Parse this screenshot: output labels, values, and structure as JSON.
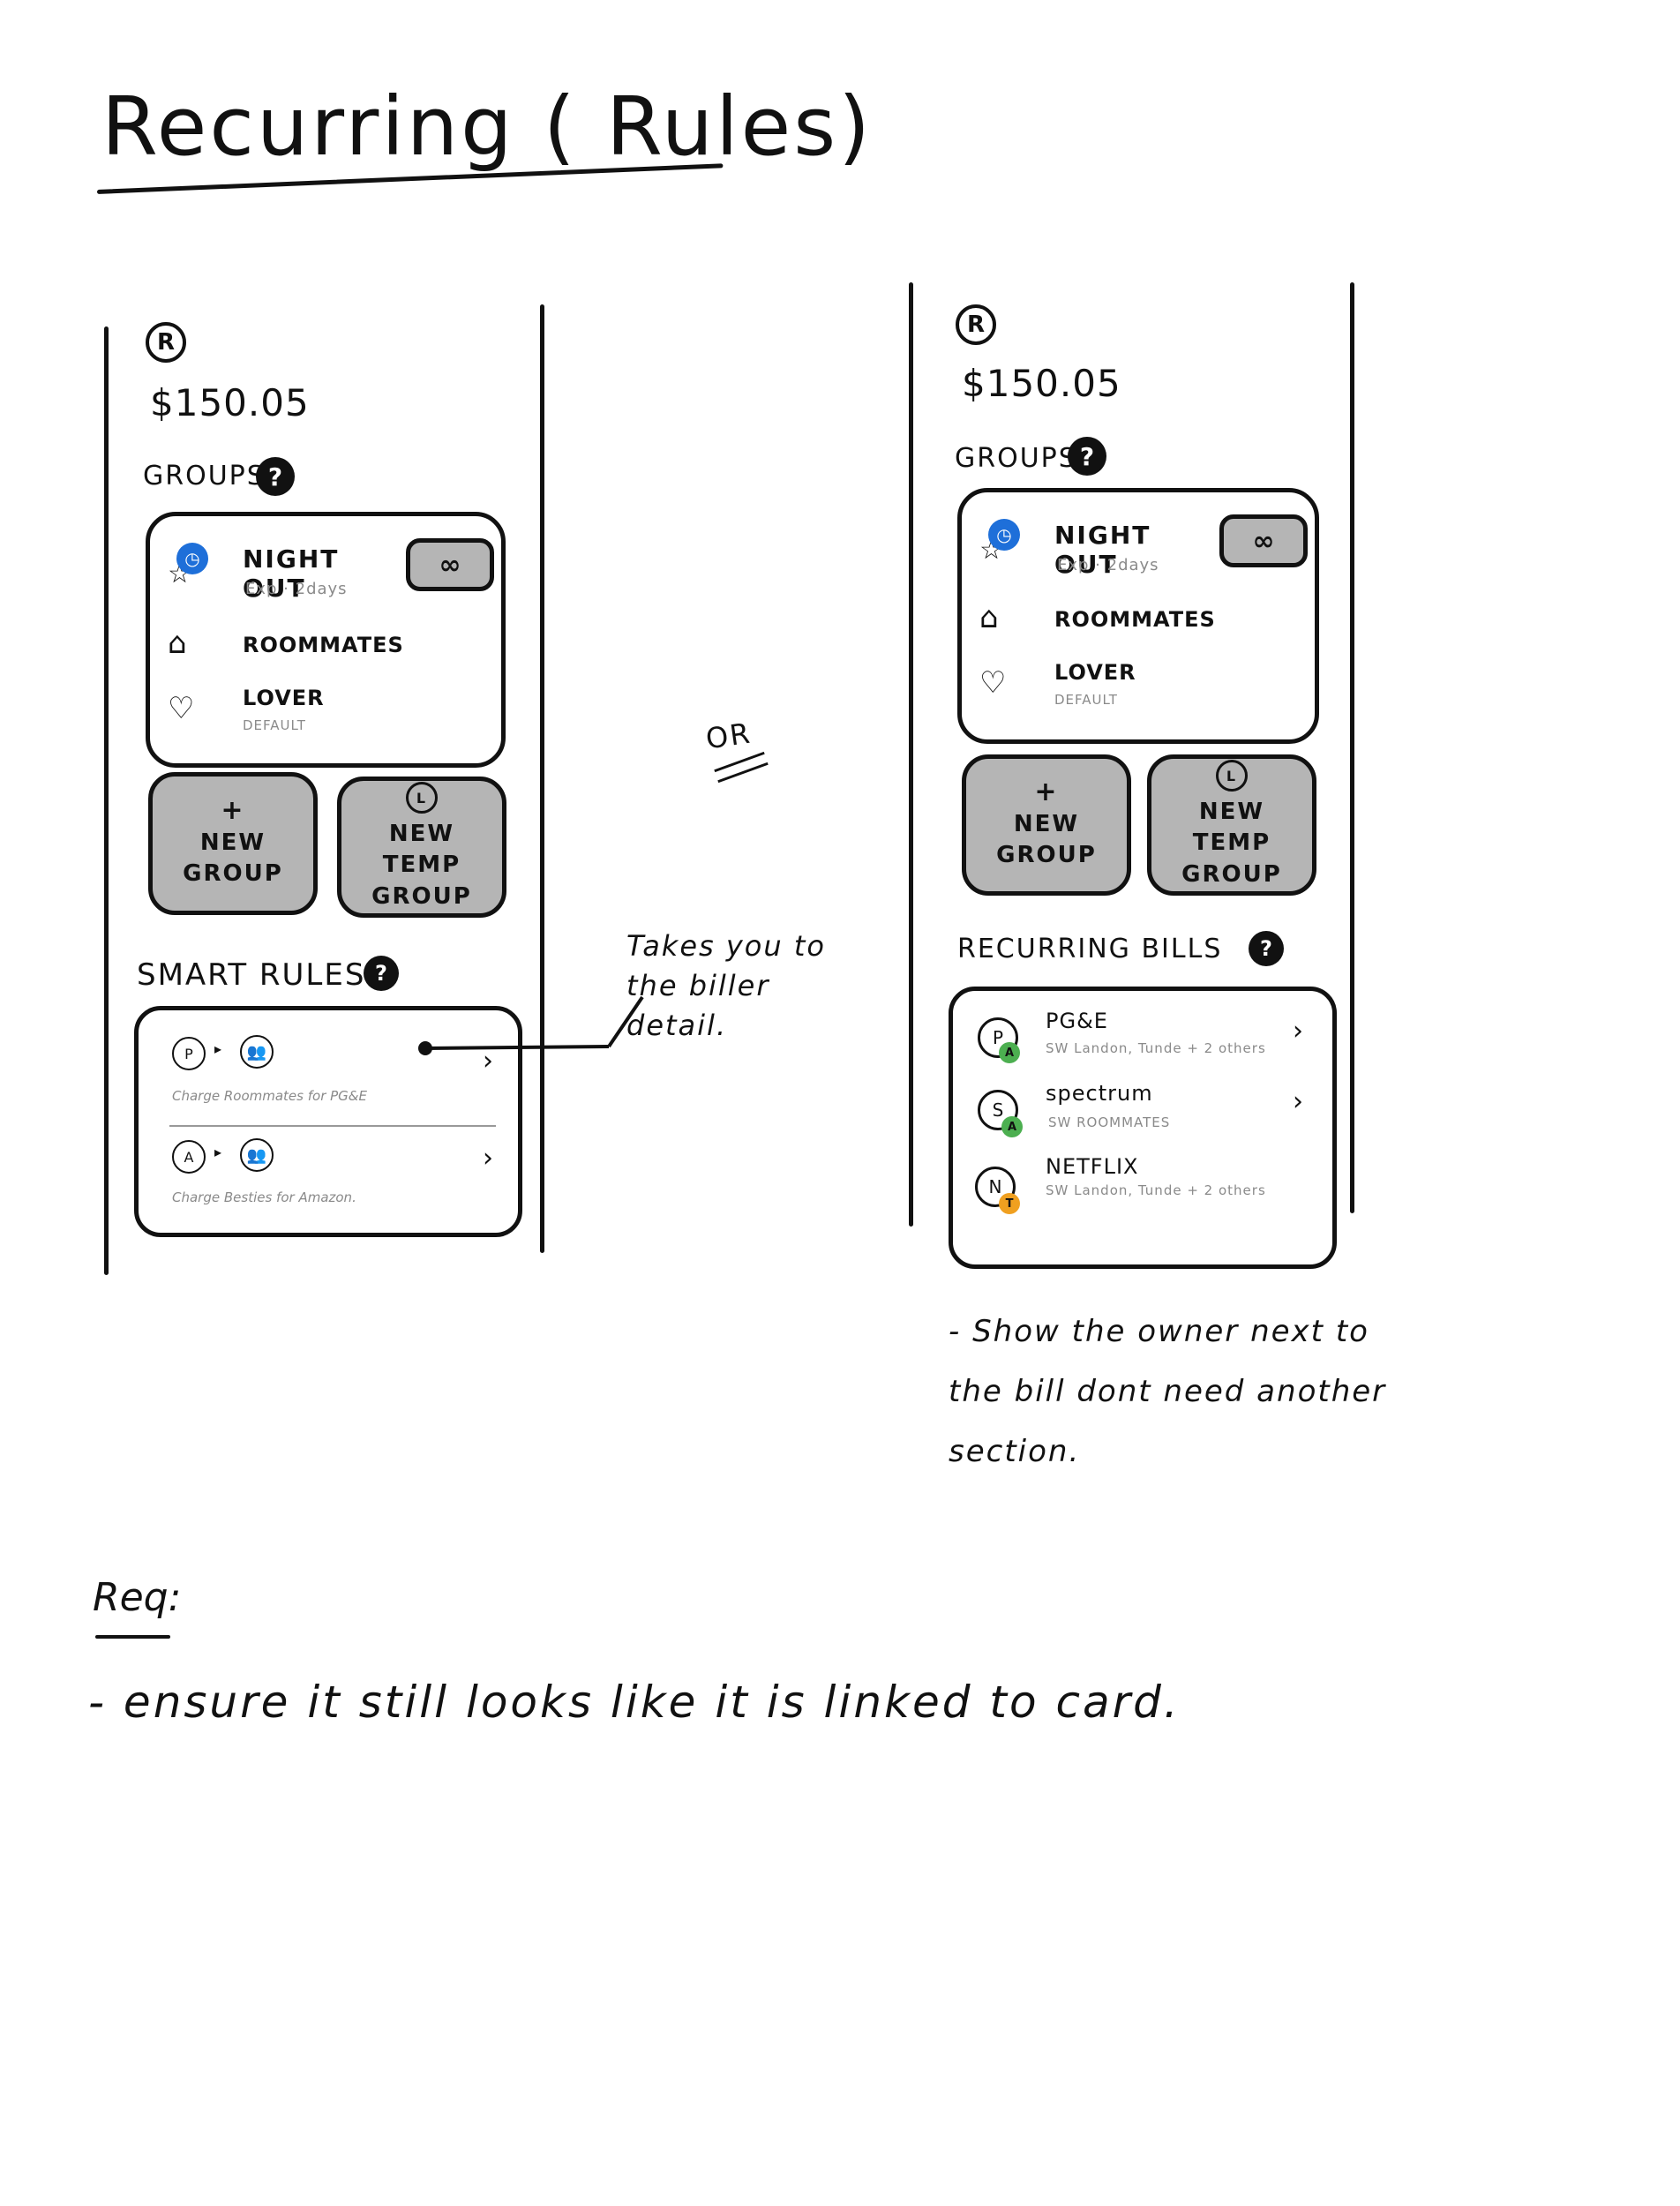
{
  "page": {
    "title": "Recurring ( Rules)",
    "or_label": "OR",
    "annotation": "Takes you to the biller detail.",
    "note": "- Show the owner next to the bill dont need another section.",
    "req_label": "Req:",
    "req_text": "- ensure it still looks like it is linked to card."
  },
  "left": {
    "logo": "R",
    "balance": "$150.05",
    "groups_label": "GROUPS",
    "help": "?",
    "groups": [
      {
        "name": "NIGHT OUT",
        "sub": "Exp · 2days",
        "icon": "star-icon"
      },
      {
        "name": "ROOMMATES",
        "sub": "",
        "icon": "home-icon"
      },
      {
        "name": "LOVER",
        "sub": "DEFAULT",
        "icon": "heart-icon"
      }
    ],
    "infinity": "∞",
    "new_group": "NEW GROUP",
    "new_temp_group": "NEW TEMP GROUP",
    "smart_rules_label": "SMART RULES",
    "rules": [
      {
        "from": "P",
        "desc": "Charge Roommates for PG&E"
      },
      {
        "from": "A",
        "desc": "Charge Besties for Amazon."
      }
    ]
  },
  "right": {
    "logo": "R",
    "balance": "$150.05",
    "groups_label": "GROUPS",
    "help": "?",
    "groups": [
      {
        "name": "NIGHT OUT",
        "sub": "Exp · 2days"
      },
      {
        "name": "ROOMMATES",
        "sub": ""
      },
      {
        "name": "LOVER",
        "sub": "DEFAULT"
      }
    ],
    "infinity": "∞",
    "new_group": "NEW GROUP",
    "new_temp_group": "NEW TEMP GROUP",
    "recurring_label": "RECURRING BILLS",
    "bills": [
      {
        "initial": "P",
        "owner": "A",
        "owner_color": "#4caf50",
        "name": "PG&E",
        "sub": "SW Landon, Tunde + 2 others",
        "chevron": true
      },
      {
        "initial": "S",
        "owner": "A",
        "owner_color": "#4caf50",
        "name": "spectrum",
        "sub": "SW ROOMMATES",
        "chevron": true
      },
      {
        "initial": "N",
        "owner": "T",
        "owner_color": "#f0a020",
        "name": "NETFLIX",
        "sub": "SW Landon, Tunde + 2 others",
        "chevron": false
      }
    ]
  },
  "colors": {
    "accent_blue": "#1e6fd9",
    "tile_gray": "#b5b5b5",
    "owner_green": "#4caf50",
    "owner_orange": "#f0a020"
  }
}
